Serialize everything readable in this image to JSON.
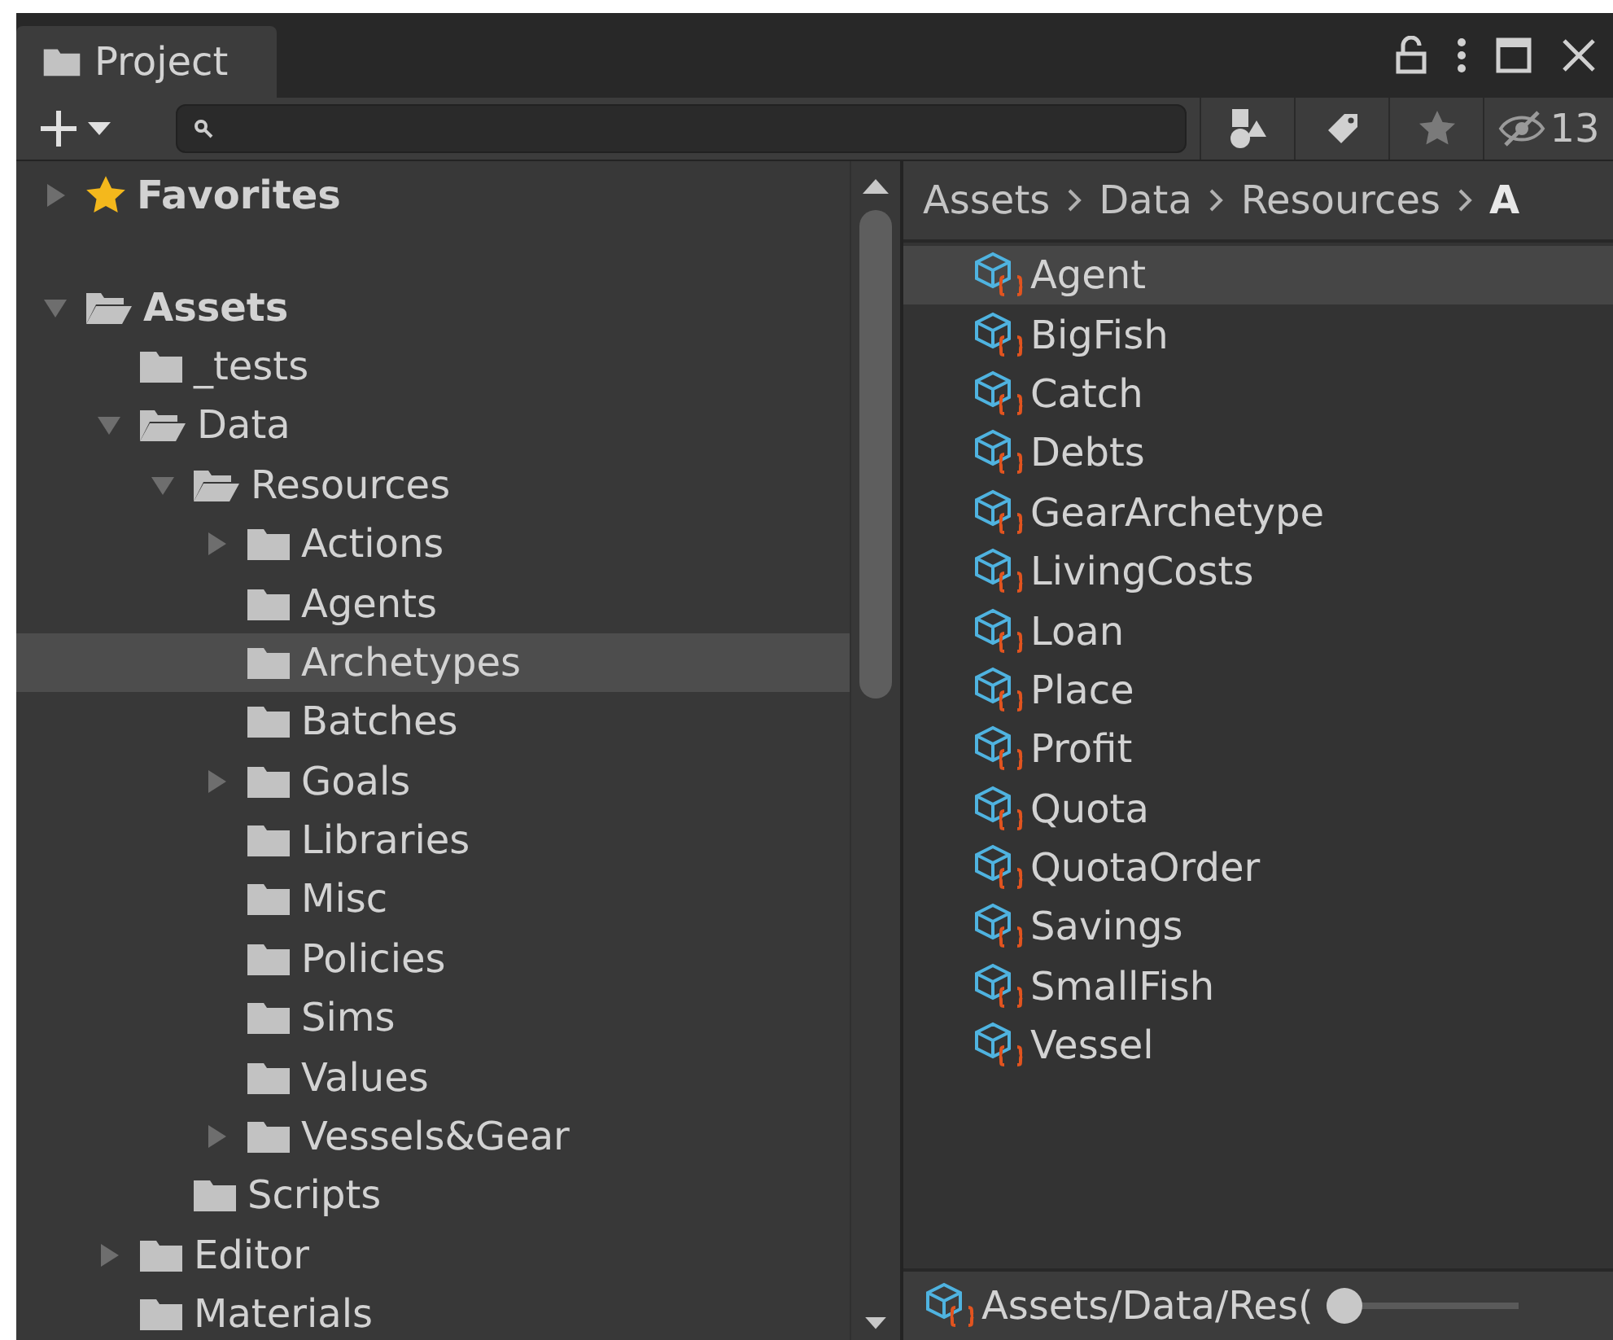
{
  "tab": {
    "label": "Project"
  },
  "toolbar": {
    "hidden_count": "13"
  },
  "tree": [
    {
      "label": "Favorites",
      "kind": "favorites",
      "bold": true,
      "has_children": true,
      "expanded": false,
      "selected": false
    },
    {
      "label": "Assets",
      "kind": "folder",
      "bold": true,
      "has_children": true,
      "expanded": true,
      "selected": false,
      "children": [
        {
          "label": "_tests",
          "kind": "folder",
          "bold": false,
          "has_children": false,
          "expanded": false,
          "selected": false
        },
        {
          "label": "Data",
          "kind": "folder",
          "bold": false,
          "has_children": true,
          "expanded": true,
          "selected": false,
          "children": [
            {
              "label": "Resources",
              "kind": "folder",
              "bold": false,
              "has_children": true,
              "expanded": true,
              "selected": false,
              "children": [
                {
                  "label": "Actions",
                  "kind": "folder",
                  "bold": false,
                  "has_children": true,
                  "expanded": false,
                  "selected": false
                },
                {
                  "label": "Agents",
                  "kind": "folder",
                  "bold": false,
                  "has_children": false,
                  "expanded": false,
                  "selected": false
                },
                {
                  "label": "Archetypes",
                  "kind": "folder",
                  "bold": false,
                  "has_children": false,
                  "expanded": false,
                  "selected": true
                },
                {
                  "label": "Batches",
                  "kind": "folder",
                  "bold": false,
                  "has_children": false,
                  "expanded": false,
                  "selected": false
                },
                {
                  "label": "Goals",
                  "kind": "folder",
                  "bold": false,
                  "has_children": true,
                  "expanded": false,
                  "selected": false
                },
                {
                  "label": "Libraries",
                  "kind": "folder",
                  "bold": false,
                  "has_children": false,
                  "expanded": false,
                  "selected": false
                },
                {
                  "label": "Misc",
                  "kind": "folder",
                  "bold": false,
                  "has_children": false,
                  "expanded": false,
                  "selected": false
                },
                {
                  "label": "Policies",
                  "kind": "folder",
                  "bold": false,
                  "has_children": false,
                  "expanded": false,
                  "selected": false
                },
                {
                  "label": "Sims",
                  "kind": "folder",
                  "bold": false,
                  "has_children": false,
                  "expanded": false,
                  "selected": false
                },
                {
                  "label": "Values",
                  "kind": "folder",
                  "bold": false,
                  "has_children": false,
                  "expanded": false,
                  "selected": false
                },
                {
                  "label": "Vessels&Gear",
                  "kind": "folder",
                  "bold": false,
                  "has_children": true,
                  "expanded": false,
                  "selected": false
                }
              ]
            },
            {
              "label": "Scripts",
              "kind": "folder",
              "bold": false,
              "has_children": false,
              "expanded": false,
              "selected": false
            }
          ]
        },
        {
          "label": "Editor",
          "kind": "folder",
          "bold": false,
          "has_children": true,
          "expanded": false,
          "selected": false
        },
        {
          "label": "Materials",
          "kind": "folder",
          "bold": false,
          "has_children": false,
          "expanded": false,
          "selected": false
        }
      ]
    }
  ],
  "breadcrumb": [
    "Assets",
    "Data",
    "Resources",
    "A"
  ],
  "files": [
    {
      "name": "Agent",
      "selected": true
    },
    {
      "name": "BigFish",
      "selected": false
    },
    {
      "name": "Catch",
      "selected": false
    },
    {
      "name": "Debts",
      "selected": false
    },
    {
      "name": "GearArchetype",
      "selected": false
    },
    {
      "name": "LivingCosts",
      "selected": false
    },
    {
      "name": "Loan",
      "selected": false
    },
    {
      "name": "Place",
      "selected": false
    },
    {
      "name": "Profit",
      "selected": false
    },
    {
      "name": "Quota",
      "selected": false
    },
    {
      "name": "QuotaOrder",
      "selected": false
    },
    {
      "name": "Savings",
      "selected": false
    },
    {
      "name": "SmallFish",
      "selected": false
    },
    {
      "name": "Vessel",
      "selected": false
    }
  ],
  "status": {
    "path": "Assets/Data/Res(",
    "zoom": {
      "level": 0
    }
  }
}
